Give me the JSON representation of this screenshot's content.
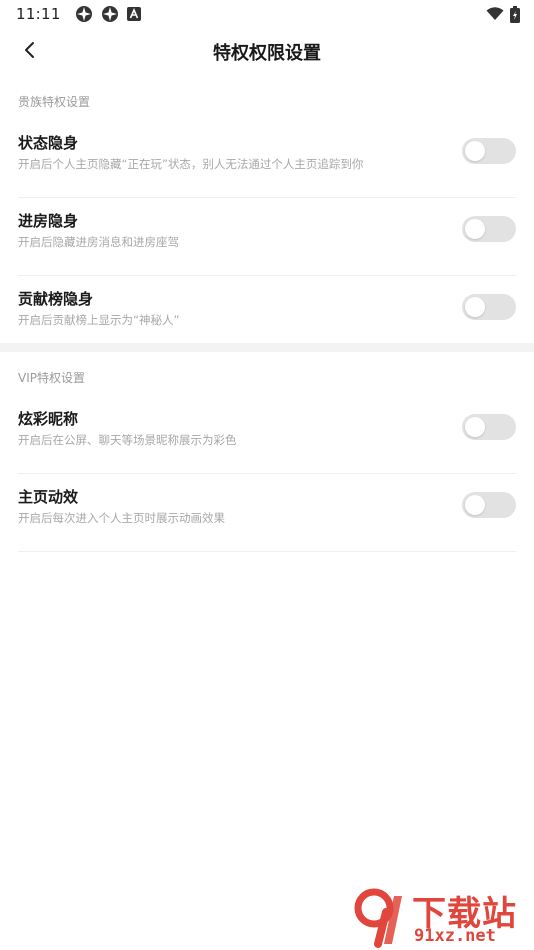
{
  "status_bar": {
    "time": "11:11",
    "left_icons": [
      "app-notification-icon",
      "app-notification-icon",
      "letter-a-notification-icon"
    ],
    "right_icons": [
      "wifi-icon",
      "battery-charging-icon"
    ]
  },
  "header": {
    "back_icon": "chevron-left-icon",
    "title": "特权权限设置"
  },
  "sections": [
    {
      "label": "贵族特权设置",
      "items": [
        {
          "title": "状态隐身",
          "desc": "开启后个人主页隐藏“正在玩”状态，别人无法通过个人主页追踪到你",
          "enabled": false
        },
        {
          "title": "进房隐身",
          "desc": "开启后隐藏进房消息和进房座驾",
          "enabled": false
        },
        {
          "title": "贡献榜隐身",
          "desc": "开启后贡献榜上显示为“神秘人”",
          "enabled": false
        }
      ]
    },
    {
      "label": "VIP特权设置",
      "items": [
        {
          "title": "炫彩昵称",
          "desc": "开启后在公屏、聊天等场景昵称展示为彩色",
          "enabled": false
        },
        {
          "title": "主页动效",
          "desc": "开启后每次进入个人主页时展示动画效果",
          "enabled": false
        }
      ]
    }
  ],
  "watermark": {
    "title": "下载站",
    "url": "91xz.net",
    "color": "#e0463b"
  },
  "colors": {
    "toggle_off": "#e2e2e2",
    "divider": "#f3f3f3"
  }
}
